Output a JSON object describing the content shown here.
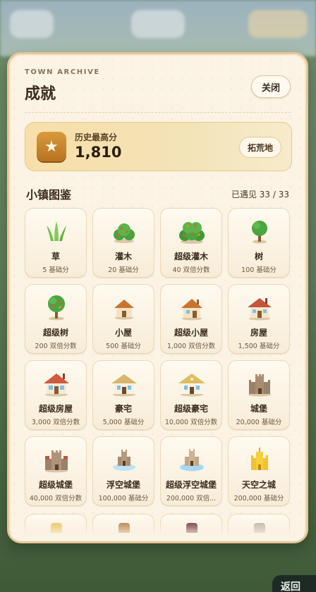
{
  "panel": {
    "eyebrow": "TOWN ARCHIVE",
    "title": "成就",
    "close_label": "关闭"
  },
  "best": {
    "label": "历史最高分",
    "value": "1,810",
    "button_label": "拓荒地",
    "icon": "star-icon"
  },
  "collection": {
    "title": "小镇图鉴",
    "count": "已遇见 33 / 33",
    "items": [
      {
        "name": "草",
        "points": "5 基础分",
        "icon": "grass-icon"
      },
      {
        "name": "灌木",
        "points": "20 基础分",
        "icon": "bush-icon"
      },
      {
        "name": "超级灌木",
        "points": "40 双倍分数",
        "icon": "super-bush-icon"
      },
      {
        "name": "树",
        "points": "100 基础分",
        "icon": "tree-icon"
      },
      {
        "name": "超级树",
        "points": "200 双倍分数",
        "icon": "super-tree-icon"
      },
      {
        "name": "小屋",
        "points": "500 基础分",
        "icon": "hut-icon"
      },
      {
        "name": "超级小屋",
        "points": "1,000 双倍分数",
        "icon": "super-hut-icon"
      },
      {
        "name": "房屋",
        "points": "1,500 基础分",
        "icon": "house-icon"
      },
      {
        "name": "超级房屋",
        "points": "3,000 双倍分数",
        "icon": "super-house-icon"
      },
      {
        "name": "豪宅",
        "points": "5,000 基础分",
        "icon": "mansion-icon"
      },
      {
        "name": "超级豪宅",
        "points": "10,000 双倍分数",
        "icon": "super-mansion-icon"
      },
      {
        "name": "城堡",
        "points": "20,000 基础分",
        "icon": "castle-icon"
      },
      {
        "name": "超级城堡",
        "points": "40,000 双倍分数",
        "icon": "super-castle-icon"
      },
      {
        "name": "浮空城堡",
        "points": "100,000 基础分",
        "icon": "floating-castle-icon"
      },
      {
        "name": "超级浮空城堡",
        "points": "200,000 双倍...",
        "icon": "super-floating-castle-icon"
      },
      {
        "name": "天空之城",
        "points": "200,000 基础分",
        "icon": "sky-city-icon"
      }
    ]
  },
  "background": {
    "bottom_button": "返回"
  },
  "colors": {
    "panel_bg": "#fbf3e4",
    "panel_border": "#e4c79a",
    "accent_gold": "#d99a3c",
    "text_dark": "#3a2b1c"
  }
}
